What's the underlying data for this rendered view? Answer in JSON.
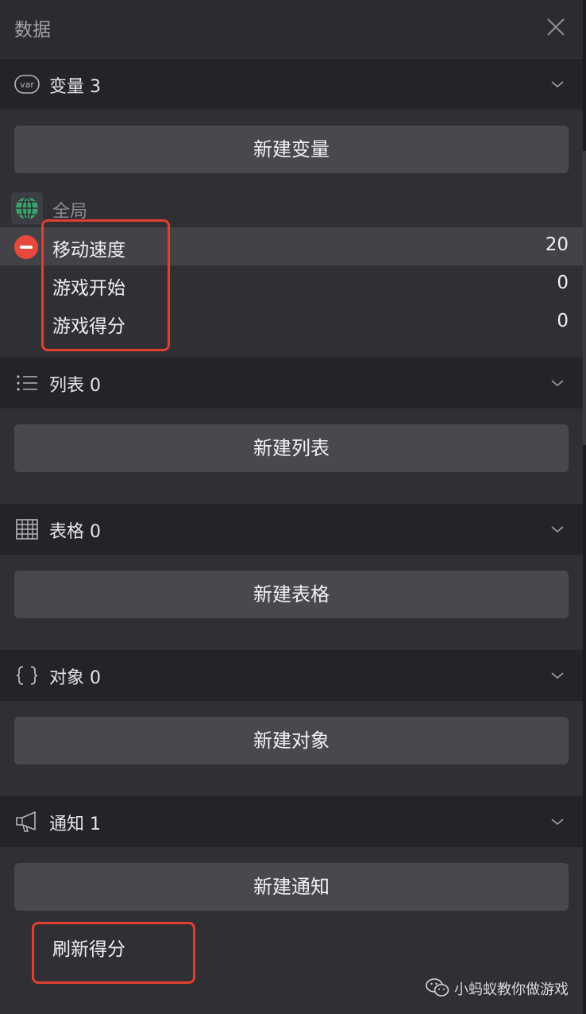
{
  "panel": {
    "title": "数据"
  },
  "variables": {
    "header": "变量 3",
    "new_button": "新建变量",
    "scope_label": "全局",
    "items": [
      {
        "name": "移动速度",
        "value": "20"
      },
      {
        "name": "游戏开始",
        "value": "0"
      },
      {
        "name": "游戏得分",
        "value": "0"
      }
    ]
  },
  "lists": {
    "header": "列表 0",
    "new_button": "新建列表"
  },
  "tables": {
    "header": "表格 0",
    "new_button": "新建表格"
  },
  "objects": {
    "header": "对象 0",
    "new_button": "新建对象"
  },
  "notifications": {
    "header": "通知 1",
    "new_button": "新建通知",
    "items": [
      {
        "name": "刷新得分"
      }
    ]
  },
  "watermark": {
    "text": "小蚂蚁教你做游戏"
  },
  "colors": {
    "panel_bg": "#2f2f34",
    "header_bg": "#242428",
    "button_bg": "#48484e",
    "highlight": "#e0402f",
    "remove": "#e8483c"
  }
}
